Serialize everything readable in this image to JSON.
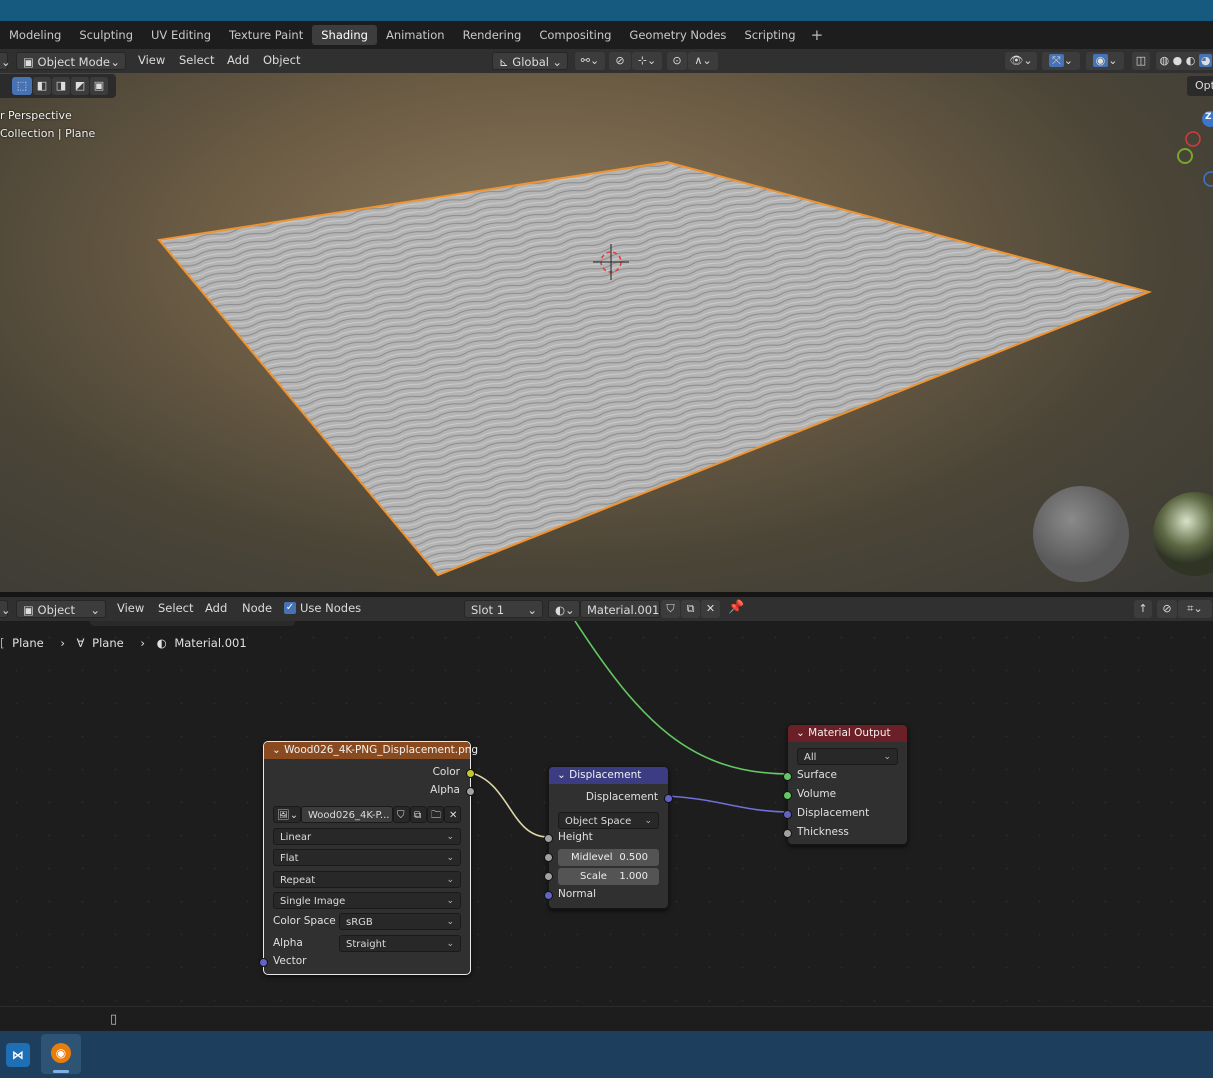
{
  "workspace_tabs": [
    "Modeling",
    "Sculpting",
    "UV Editing",
    "Texture Paint",
    "Shading",
    "Animation",
    "Rendering",
    "Compositing",
    "Geometry Nodes",
    "Scripting"
  ],
  "active_tab": "Shading",
  "add_tab_symbol": "+",
  "viewport_header": {
    "mode": "Object Mode",
    "menus": [
      "View",
      "Select",
      "Add",
      "Object"
    ],
    "orientation": "Global",
    "options_label": "Opt"
  },
  "viewport": {
    "perspective_label": "r Perspective",
    "collection_label": "Collection | Plane",
    "gizmo_z": "Z"
  },
  "node_header": {
    "mode": "Object",
    "menus": [
      "View",
      "Select",
      "Add",
      "Node"
    ],
    "use_nodes_label": "Use Nodes",
    "use_nodes_checked": true,
    "slot": "Slot 1",
    "material": "Material.001"
  },
  "breadcrumb": [
    "Plane",
    "Plane",
    "Material.001"
  ],
  "image_node": {
    "title": "Wood026_4K-PNG_Displacement.png",
    "outputs": [
      "Color",
      "Alpha"
    ],
    "image_name": "Wood026_4K-P...",
    "interpolation": "Linear",
    "projection": "Flat",
    "extension": "Repeat",
    "source": "Single Image",
    "color_space_label": "Color Space",
    "color_space": "sRGB",
    "alpha_label": "Alpha",
    "alpha_mode": "Straight",
    "input": "Vector"
  },
  "displacement_node": {
    "title": "Displacement",
    "output": "Displacement",
    "space": "Object Space",
    "height_label": "Height",
    "midlevel_label": "Midlevel",
    "midlevel_value": "0.500",
    "scale_label": "Scale",
    "scale_value": "1.000",
    "normal_label": "Normal"
  },
  "output_node": {
    "title": "Material Output",
    "target": "All",
    "inputs": [
      "Surface",
      "Volume",
      "Displacement",
      "Thickness"
    ]
  },
  "colors": {
    "title_bar": "#165a80",
    "selection_orange": "#f0922e",
    "image_node_header": "#8a4a20",
    "displacement_node_header": "#3c3c83",
    "output_node_header": "#6b1f26",
    "socket_color": "#c7c729",
    "socket_gray": "#a1a1a1",
    "socket_vector": "#6363c7",
    "socket_shader": "#63c763",
    "taskbar": "#1e3e5e"
  }
}
